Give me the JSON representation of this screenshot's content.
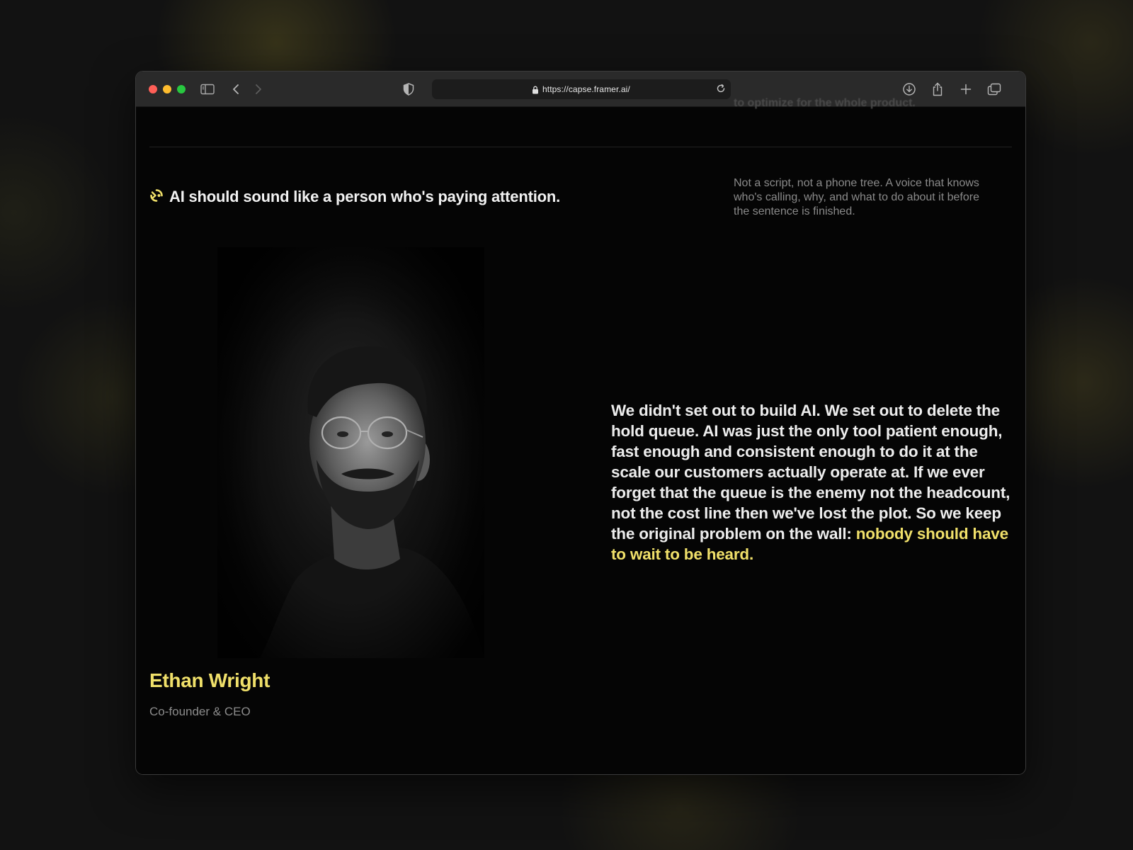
{
  "browser": {
    "url": "https://capse.framer.ai/"
  },
  "section": {
    "cut_off_text": "to optimize for the whole product.",
    "heading": "AI should sound like a person who's paying attention.",
    "side_note": "Not a script, not a phone tree. A voice that knows who's calling, why, and what to do about it before the sentence is finished."
  },
  "founder": {
    "name": "Ethan Wright",
    "role": "Co-founder & CEO",
    "quote": "We didn't set out to build AI. We set out to delete the hold queue. AI was just the only tool patient enough, fast enough and consistent enough to do it at the scale our customers actually operate at. If we ever forget that the queue is the enemy not the headcount, not the cost line then we've lost the plot. So we keep the original problem on the wall:",
    "quote_highlight": "nobody should have to wait to be heard."
  },
  "colors": {
    "accent": "#f0e06a",
    "background": "#050505",
    "toolbar": "#2a2a2a"
  },
  "icons": {
    "brand": "capse-logo-icon",
    "sidebar": "sidebar-icon",
    "back": "chevron-left-icon",
    "forward": "chevron-right-icon",
    "privacy": "shield-icon",
    "lock": "lock-icon",
    "reload": "reload-icon",
    "download": "download-icon",
    "share": "share-icon",
    "new_tab": "plus-icon",
    "tabs": "tabs-overview-icon"
  }
}
